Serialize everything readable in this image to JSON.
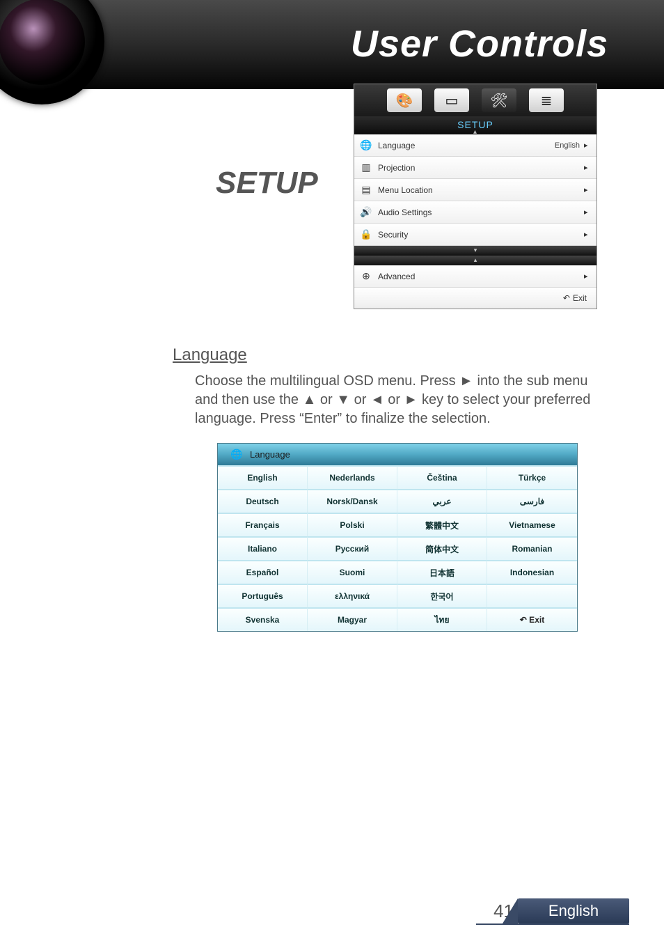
{
  "header": {
    "title": "User Controls"
  },
  "section_title": "SETUP",
  "osd": {
    "heading": "SETUP",
    "tabs": [
      {
        "icon": "🎨",
        "name": "image-tab"
      },
      {
        "icon": "▭",
        "name": "display-tab"
      },
      {
        "icon": "🛠",
        "name": "setup-tab"
      },
      {
        "icon": "≣",
        "name": "options-tab"
      }
    ],
    "rows_top": [
      {
        "icon": "🌐",
        "label": "Language",
        "value": "English",
        "name": "row-language"
      },
      {
        "icon": "▥",
        "label": "Projection",
        "value": "",
        "name": "row-projection"
      },
      {
        "icon": "▤",
        "label": "Menu Location",
        "value": "",
        "name": "row-menu-location"
      },
      {
        "icon": "🔊",
        "label": "Audio Settings",
        "value": "",
        "name": "row-audio-settings"
      },
      {
        "icon": "🔒",
        "label": "Security",
        "value": "",
        "name": "row-security"
      }
    ],
    "rows_bottom": [
      {
        "icon": "⊕",
        "label": "Advanced",
        "value": "",
        "name": "row-advanced"
      }
    ],
    "exit_label": "Exit"
  },
  "body": {
    "heading": "Language",
    "paragraph": "Choose the multilingual OSD menu. Press ► into the sub menu and then use the ▲ or ▼ or ◄ or ► key to select your preferred language. Press “Enter” to finalize the selection."
  },
  "lang_panel": {
    "title": "Language",
    "cells": [
      "English",
      "Nederlands",
      "Čeština",
      "Türkçe",
      "Deutsch",
      "Norsk/Dansk",
      "عربي",
      "فارسی",
      "Français",
      "Polski",
      "繁體中文",
      "Vietnamese",
      "Italiano",
      "Русский",
      "简体中文",
      "Romanian",
      "Español",
      "Suomi",
      "日本語",
      "Indonesian",
      "Português",
      "ελληνικά",
      "한국어",
      "",
      "Svenska",
      "Magyar",
      "ไทย",
      "↶ Exit"
    ]
  },
  "footer": {
    "page": "41",
    "lang": "English"
  }
}
